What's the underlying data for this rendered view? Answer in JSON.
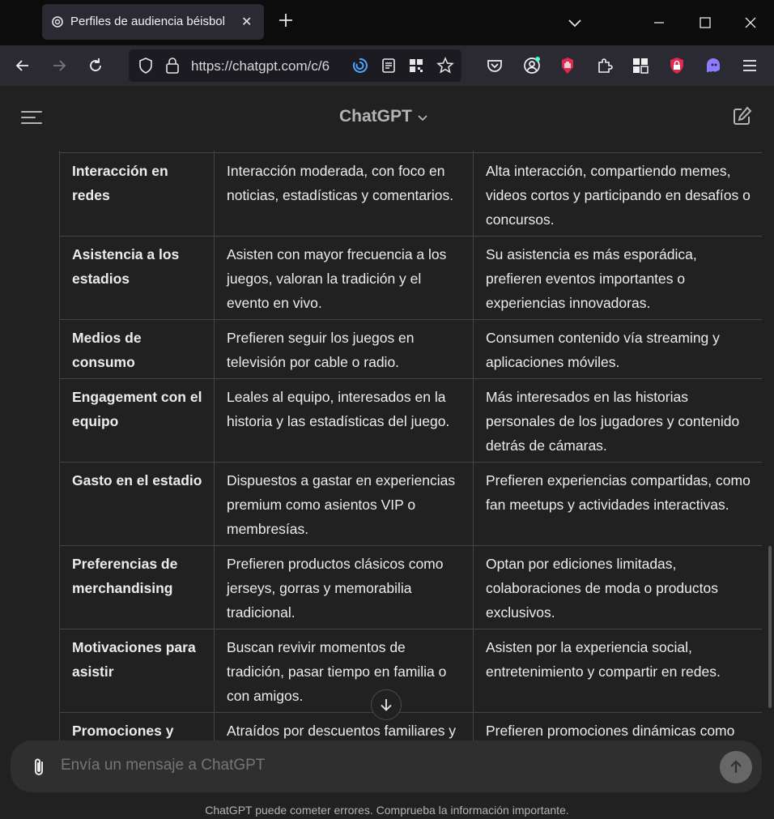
{
  "browser": {
    "tab": {
      "title": "Perfiles de audiencia béisbol"
    },
    "url": "https://chatgpt.com/c/6"
  },
  "app": {
    "model_title": "ChatGPT"
  },
  "table": {
    "rows": [
      {
        "attr": "Interacción en redes",
        "c1": "Interacción moderada, con foco en noticias, estadísticas y comentarios.",
        "c2": "Alta interacción, compartiendo memes, videos cortos y participando en desafíos o concursos."
      },
      {
        "attr": "Asistencia a los estadios",
        "c1": "Asisten con mayor frecuencia a los juegos, valoran la tradición y el evento en vivo.",
        "c2": "Su asistencia es más esporádica, prefieren eventos importantes o experiencias innovadoras."
      },
      {
        "attr": "Medios de consumo",
        "c1": "Prefieren seguir los juegos en televisión por cable o radio.",
        "c2": "Consumen contenido vía streaming y aplicaciones móviles."
      },
      {
        "attr": "Engagement con el equipo",
        "c1": "Leales al equipo, interesados en la historia y las estadísticas del juego.",
        "c2": "Más interesados en las historias personales de los jugadores y contenido detrás de cámaras."
      },
      {
        "attr": "Gasto en el estadio",
        "c1": "Dispuestos a gastar en experiencias premium como asientos VIP o membresías.",
        "c2": "Prefieren experiencias compartidas, como fan meetups y actividades interactivas."
      },
      {
        "attr": "Preferencias de merchandising",
        "c1": "Prefieren productos clásicos como jerseys, gorras y memorabilia tradicional.",
        "c2": "Optan por ediciones limitadas, colaboraciones de moda o productos exclusivos."
      },
      {
        "attr": "Motivaciones para asistir",
        "c1": "Buscan revivir momentos de tradición, pasar tiempo en familia o con amigos.",
        "c2": "Asisten por la experiencia social, entretenimiento y compartir en redes."
      },
      {
        "attr": "Promociones y descuentos",
        "c1": "Atraídos por descuentos familiares y ofertas de larga duración.",
        "c2": "Prefieren promociones dinámicas como concursos, giveaways o experiencias"
      }
    ]
  },
  "composer": {
    "placeholder": "Envía un mensaje a ChatGPT"
  },
  "footer": {
    "disclaimer": "ChatGPT puede cometer errores. Comprueba la información importante."
  }
}
